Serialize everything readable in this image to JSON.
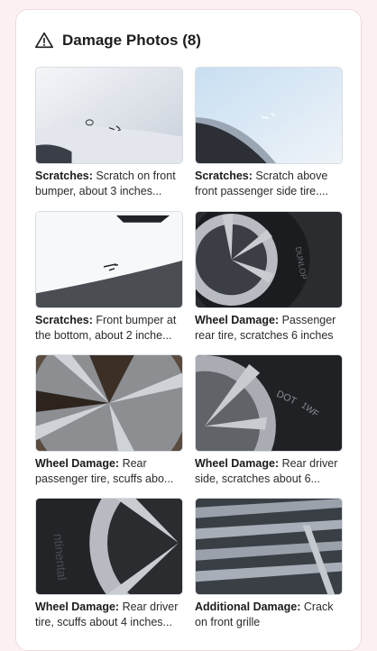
{
  "header": {
    "title": "Damage Photos (8)",
    "icon": "warning-triangle-icon"
  },
  "photos": [
    {
      "category": "Scratches:",
      "description": "Scratch on front bumper, about 3 inches..."
    },
    {
      "category": "Scratches:",
      "description": "Scratch above front passenger side tire...."
    },
    {
      "category": "Scratches:",
      "description": "Front bumper at the bottom, about 2 inche..."
    },
    {
      "category": "Wheel Damage:",
      "description": "Passenger rear tire, scratches 6 inches"
    },
    {
      "category": "Wheel Damage:",
      "description": "Rear passenger tire, scuffs abo..."
    },
    {
      "category": "Wheel Damage:",
      "description": "Rear driver side, scratches about 6..."
    },
    {
      "category": "Wheel Damage:",
      "description": "Rear driver tire, scuffs about 4 inches..."
    },
    {
      "category": "Additional Damage:",
      "description": "Crack on front grille"
    }
  ]
}
